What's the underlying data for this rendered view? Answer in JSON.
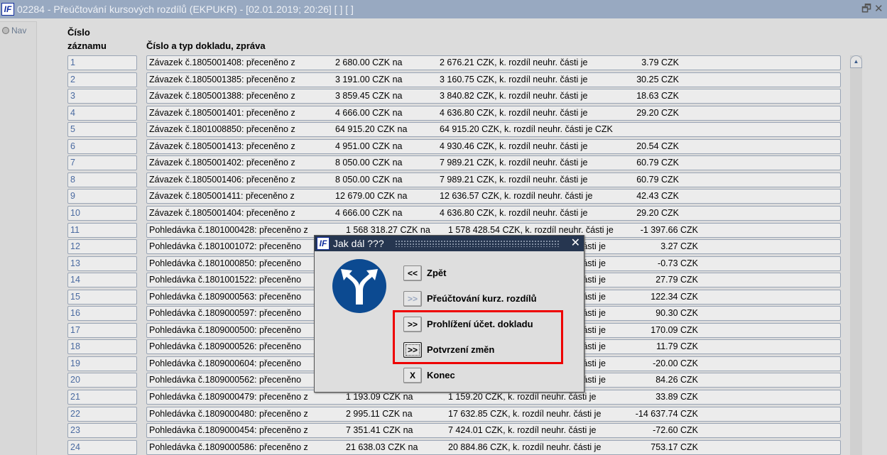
{
  "window": {
    "title": "02284 - Přeúčtování kursových rozdílů (EKPUKR) - [02.01.2019; 20:26]  [ ]  [ ]",
    "logo": "IF",
    "restore_icon": "restore-icon",
    "close_icon": "close-icon"
  },
  "nav": {
    "label": "Nav"
  },
  "headers": {
    "number": "Číslo",
    "number2": "záznamu",
    "text": "Číslo a typ dokladu, zpráva"
  },
  "rows": [
    {
      "n": "1",
      "doc": "Závazek č.1805001408: přeceněno z",
      "from": "2 680.00 CZK na",
      "to": "2 676.21 CZK, k. rozdíl neuhr. části je",
      "diff": "3.79 CZK"
    },
    {
      "n": "2",
      "doc": "Závazek č.1805001385: přeceněno z",
      "from": "3 191.00 CZK na",
      "to": "3 160.75 CZK, k. rozdíl neuhr. části je",
      "diff": "30.25 CZK"
    },
    {
      "n": "3",
      "doc": "Závazek č.1805001388: přeceněno z",
      "from": "3 859.45 CZK na",
      "to": "3 840.82 CZK, k. rozdíl neuhr. části je",
      "diff": "18.63 CZK"
    },
    {
      "n": "4",
      "doc": "Závazek č.1805001401: přeceněno z",
      "from": "4 666.00 CZK na",
      "to": "4 636.80 CZK, k. rozdíl neuhr. části je",
      "diff": "29.20 CZK"
    },
    {
      "n": "5",
      "doc": "Závazek č.1801008850: přeceněno z",
      "from": "64 915.20 CZK na",
      "to": "64 915.20 CZK, k. rozdíl neuhr. části je  CZK",
      "diff": ""
    },
    {
      "n": "6",
      "doc": "Závazek č.1805001413: přeceněno z",
      "from": "4 951.00 CZK na",
      "to": "4 930.46 CZK, k. rozdíl neuhr. části je",
      "diff": "20.54 CZK"
    },
    {
      "n": "7",
      "doc": "Závazek č.1805001402: přeceněno z",
      "from": "8 050.00 CZK na",
      "to": "7 989.21 CZK, k. rozdíl neuhr. části je",
      "diff": "60.79 CZK"
    },
    {
      "n": "8",
      "doc": "Závazek č.1805001406: přeceněno z",
      "from": "8 050.00 CZK na",
      "to": "7 989.21 CZK, k. rozdíl neuhr. části je",
      "diff": "60.79 CZK"
    },
    {
      "n": "9",
      "doc": "Závazek č.1805001411: přeceněno z",
      "from": "12 679.00 CZK na",
      "to": "12 636.57 CZK, k. rozdíl neuhr. části je",
      "diff": "42.43 CZK"
    },
    {
      "n": "10",
      "doc": "Závazek č.1805001404: přeceněno z",
      "from": "4 666.00 CZK na",
      "to": "4 636.80 CZK, k. rozdíl neuhr. části je",
      "diff": "29.20 CZK"
    },
    {
      "n": "11",
      "doc": "Pohledávka č.1801000428: přeceněno z",
      "from": "1 568 318.27 CZK na",
      "to": "1 578 428.54 CZK, k. rozdíl neuhr. části je",
      "diff": "-1 397.66 CZK"
    },
    {
      "n": "12",
      "doc": "Pohledávka č.1801001072: přeceněno",
      "from": "",
      "to": "části je",
      "diff": "3.27 CZK",
      "hidden": true
    },
    {
      "n": "13",
      "doc": "Pohledávka č.1801000850: přeceněno",
      "from": "",
      "to": "části je",
      "diff": "-0.73 CZK",
      "hidden": true
    },
    {
      "n": "14",
      "doc": "Pohledávka č.1801001522: přeceněno",
      "from": "",
      "to": "části je",
      "diff": "27.79 CZK",
      "hidden": true
    },
    {
      "n": "15",
      "doc": "Pohledávka č.1809000563: přeceněno",
      "from": "",
      "to": "části je",
      "diff": "122.34 CZK",
      "hidden": true
    },
    {
      "n": "16",
      "doc": "Pohledávka č.1809000597: přeceněno",
      "from": "",
      "to": "části je",
      "diff": "90.30 CZK",
      "hidden": true
    },
    {
      "n": "17",
      "doc": "Pohledávka č.1809000500: přeceněno",
      "from": "",
      "to": "části je",
      "diff": "170.09 CZK",
      "hidden": true
    },
    {
      "n": "18",
      "doc": "Pohledávka č.1809000526: přeceněno",
      "from": "",
      "to": "části je",
      "diff": "11.79 CZK",
      "hidden": true
    },
    {
      "n": "19",
      "doc": "Pohledávka č.1809000604: přeceněno",
      "from": "",
      "to": "části je",
      "diff": "-20.00 CZK",
      "hidden": true
    },
    {
      "n": "20",
      "doc": "Pohledávka č.1809000562: přeceněno",
      "from": "",
      "to": "části je",
      "diff": "84.26 CZK",
      "hidden": true
    },
    {
      "n": "21",
      "doc": "Pohledávka č.1809000479: přeceněno z",
      "from": "1 193.09 CZK na",
      "to": "1 159.20 CZK, k. rozdíl neuhr. části je",
      "diff": "33.89 CZK"
    },
    {
      "n": "22",
      "doc": "Pohledávka č.1809000480: přeceněno z",
      "from": "2 995.11 CZK na",
      "to": "17 632.85 CZK, k. rozdíl neuhr. části je",
      "diff": "-14 637.74 CZK"
    },
    {
      "n": "23",
      "doc": "Pohledávka č.1809000454: přeceněno z",
      "from": "7 351.41 CZK na",
      "to": "7 424.01 CZK, k. rozdíl neuhr. části je",
      "diff": "-72.60 CZK"
    },
    {
      "n": "24",
      "doc": "Pohledávka č.1809000586: přeceněno z",
      "from": "21 638.03 CZK na",
      "to": "20 884.86 CZK, k. rozdíl neuhr. části je",
      "diff": "753.17 CZK"
    }
  ],
  "dialog": {
    "title": "Jak dál ???",
    "logo": "IF",
    "close": "✕",
    "icon": "road-fork-sign-icon",
    "buttons": [
      {
        "btn": "<<",
        "label": "Zpět"
      },
      {
        "btn": ">>",
        "label": "Přeúčtování kurz. rozdílů",
        "disabled": true
      },
      {
        "btn": ">>",
        "label": "Prohlížení účet. dokladu"
      },
      {
        "btn": ">>",
        "label": "Potvrzení změn",
        "focused": true
      },
      {
        "btn": "X",
        "label": "Konec"
      }
    ],
    "highlight_color": "#ee0000"
  }
}
